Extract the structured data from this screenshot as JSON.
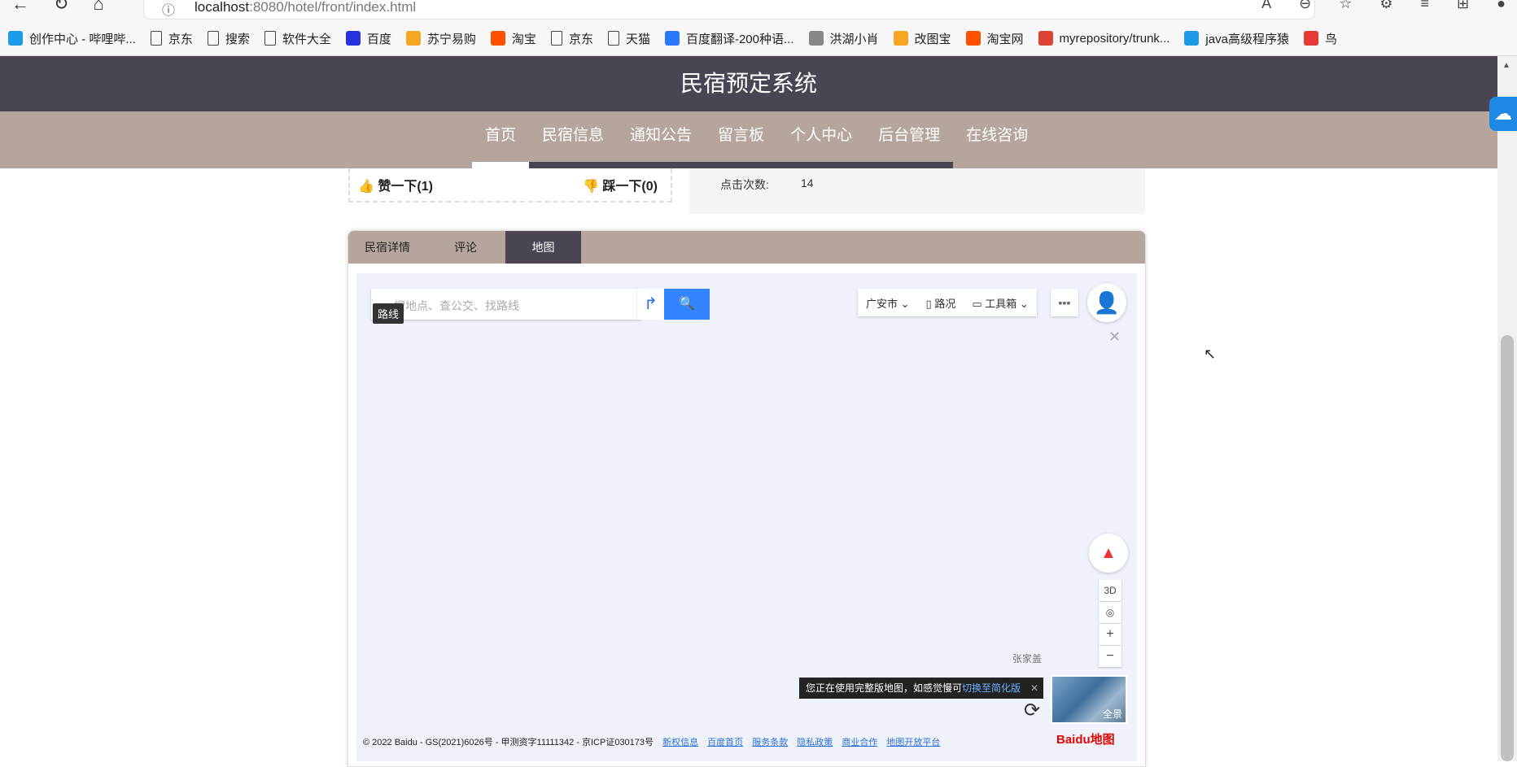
{
  "browser": {
    "url_host": "localhost",
    "url_rest": ":8080/hotel/front/index.html",
    "bookmarks": [
      {
        "label": "创作中心 - 哔哩哔...",
        "icon": "bilibili-icon",
        "color": "#1e9be8"
      },
      {
        "label": "京东",
        "icon": "page-icon",
        "color": ""
      },
      {
        "label": "搜索",
        "icon": "page-icon",
        "color": ""
      },
      {
        "label": "软件大全",
        "icon": "page-icon",
        "color": ""
      },
      {
        "label": "百度",
        "icon": "baidu-paw-icon",
        "color": "#2932e1"
      },
      {
        "label": "苏宁易购",
        "icon": "suning-icon",
        "color": "#f5a623"
      },
      {
        "label": "淘宝",
        "icon": "taobao-icon",
        "color": "#ff5000"
      },
      {
        "label": "京东",
        "icon": "page-icon",
        "color": ""
      },
      {
        "label": "天猫",
        "icon": "page-icon",
        "color": ""
      },
      {
        "label": "百度翻译-200种语...",
        "icon": "translate-icon",
        "color": "#2979ff"
      },
      {
        "label": "洪湖小肖",
        "icon": "avatar-icon",
        "color": "#888"
      },
      {
        "label": "改图宝",
        "icon": "gaitubao-icon",
        "color": "#f5a623"
      },
      {
        "label": "淘宝网",
        "icon": "taobao-icon",
        "color": "#ff5000"
      },
      {
        "label": "myrepository/trunk...",
        "icon": "chrome-icon",
        "color": "#db4437"
      },
      {
        "label": "java高级程序猿",
        "icon": "bilibili-icon",
        "color": "#1e9be8"
      },
      {
        "label": "鸟",
        "icon": "bird-icon",
        "color": "#e53935"
      }
    ]
  },
  "site": {
    "title": "民宿预定系统",
    "nav": [
      "首页",
      "民宿信息",
      "通知公告",
      "留言板",
      "个人中心",
      "后台管理",
      "在线咨询"
    ],
    "like_label": "赞一下(1)",
    "dislike_label": "踩一下(0)",
    "clicks_label": "点击次数:",
    "clicks_value": "14",
    "tabs": [
      "民宿详情",
      "评论",
      "地图"
    ],
    "active_tab": "地图"
  },
  "map": {
    "search_placeholder": "搜地点、查公交、找路线",
    "route_tip": "路线",
    "city": "广安市",
    "traffic": "路况",
    "toolbox": "工具箱",
    "btn_3d": "3D",
    "zoom_in": "+",
    "zoom_out": "−",
    "place_label": "张家盖",
    "notice_text": "您正在使用完整版地图，如感觉慢可",
    "notice_link": "切换至简化版",
    "pano_label": "全景",
    "copyright": "© 2022 Baidu - GS(2021)6026号 - 甲测资字11111342 - 京ICP证030173号",
    "footer_links": [
      "新权信息",
      "百度首页",
      "服务条款",
      "隐私政策",
      "商业合作",
      "地图开放平台"
    ],
    "logo": "Baidu地图",
    "colors": {
      "search": "#3385ff",
      "map_bg": "#eff2fb"
    }
  },
  "colors": {
    "header": "#4b4452",
    "nav": "#b5a59d"
  }
}
